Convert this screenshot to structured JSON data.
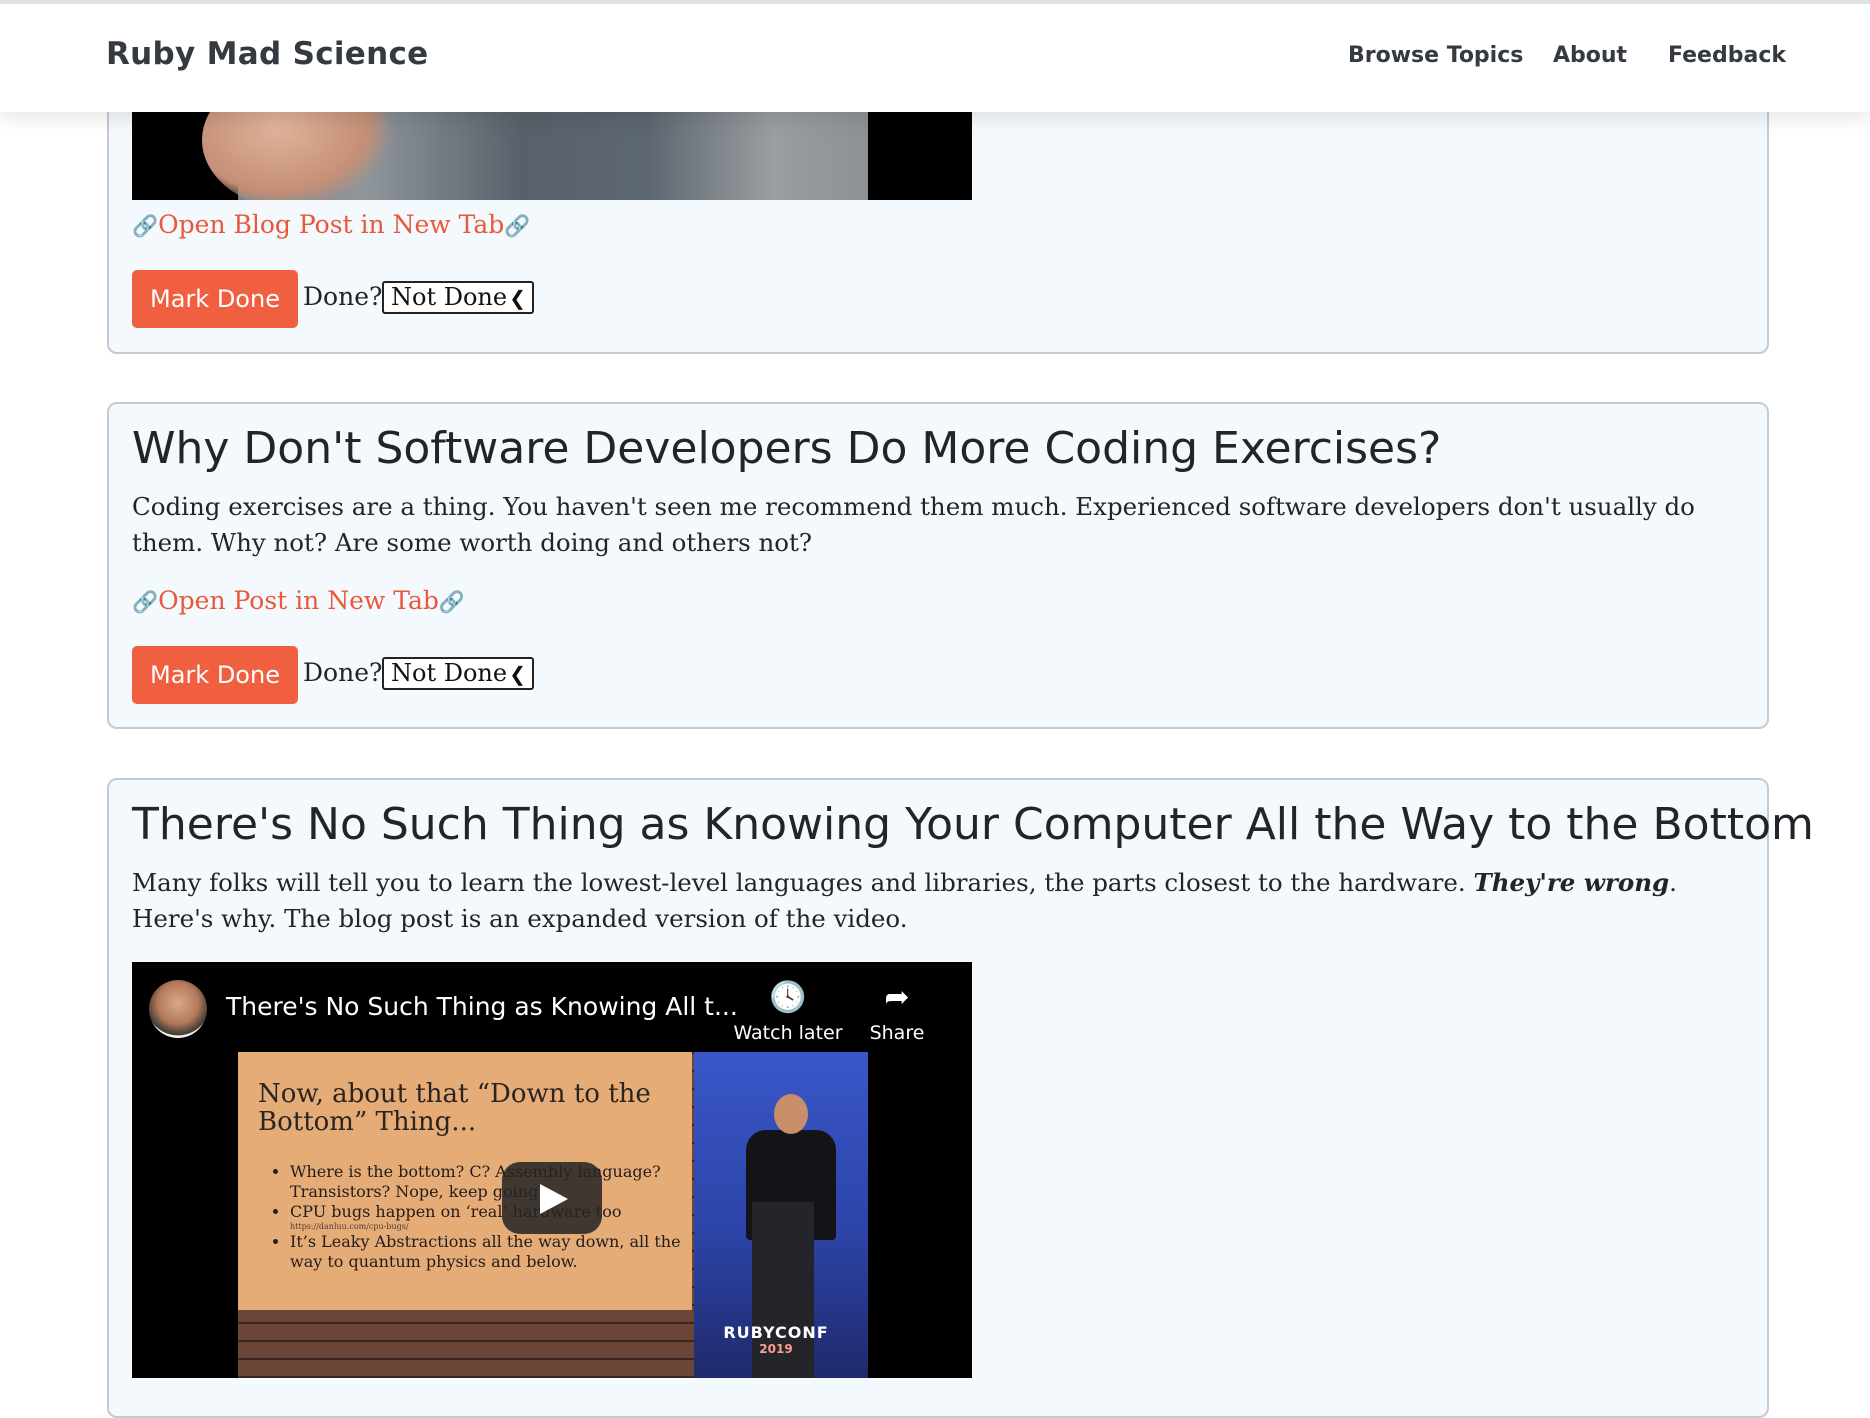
{
  "navbar": {
    "brand": "Ruby Mad Science",
    "links": [
      "Browse Topics",
      "About",
      "Feedback"
    ]
  },
  "cards": [
    {
      "link_text": "Open Blog Post in New Tab",
      "button_label": "Mark Done",
      "done_label": "Done?",
      "status_value": "Not Done"
    },
    {
      "title": "Why Don't Software Developers Do More Coding Exercises?",
      "description": "Coding exercises are a thing. You haven't seen me recommend them much. Experienced software developers don't usually do them. Why not? Are some worth doing and others not?",
      "link_text": "Open Post in New Tab",
      "button_label": "Mark Done",
      "done_label": "Done?",
      "status_value": "Not Done"
    },
    {
      "title": "There's No Such Thing as Knowing Your Computer All the Way to the Bottom",
      "description_before": "Many folks will tell you to learn the lowest-level languages and libraries, the parts closest to the hardware. ",
      "description_emphasis": "They're wrong",
      "description_after": ". Here's why. The blog post is an expanded version of the video.",
      "video": {
        "title": "There's No Such Thing as Knowing All t...",
        "watch_later_label": "Watch later",
        "share_label": "Share",
        "slide_title": "Now, about that “Down to the Bottom” Thing...",
        "slide_bullets": [
          "Where is the bottom? C? Assembly language? Transistors? Nope, keep going.",
          "CPU bugs happen on ‘real’ hardware too",
          "It’s Leaky Abstractions all the way down, all the way to quantum physics and below."
        ],
        "slide_small_link": "https://danluu.com/cpu-bugs/",
        "conference_name": "RUBYCONF",
        "conference_year": "2019"
      }
    }
  ],
  "icons": {
    "link": "link-icon",
    "select_chevron": "chevron-down-icon",
    "watch_later": "clock-icon",
    "share": "share-arrow-icon",
    "play": "play-icon"
  },
  "colors": {
    "accent": "#f05f40",
    "link": "#e8593a",
    "card_bg": "#f4f9fd",
    "card_border": "#c4cbd2"
  }
}
